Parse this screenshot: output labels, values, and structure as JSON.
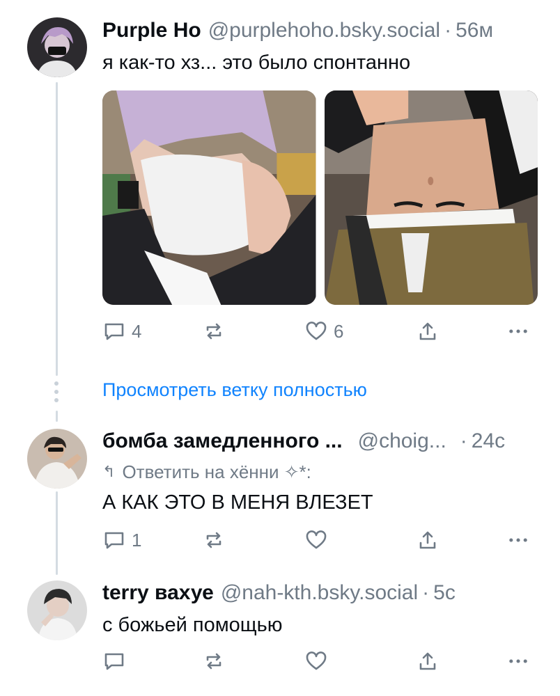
{
  "posts": [
    {
      "author": "Purple Ho",
      "handle": "@purplehoho.bsky.social",
      "time": "56м",
      "text": "я как-то хз... это было спонтанно",
      "actions": {
        "replies": "4",
        "reposts": "",
        "likes": "6"
      }
    },
    {
      "author": "бомба замедленного ...",
      "handle": "@choig...",
      "time": "24с",
      "reply_to": "Ответить на хённи ✧*:",
      "text": "А КАК ЭТО В МЕНЯ ВЛЕЗЕТ",
      "actions": {
        "replies": "1",
        "reposts": "",
        "likes": ""
      }
    },
    {
      "author": "terry вахуе",
      "handle": "@nah-kth.bsky.social",
      "time": "5с",
      "text": "с божьей помощью",
      "actions": {
        "replies": "",
        "reposts": "",
        "likes": ""
      }
    }
  ],
  "view_full_thread": "Просмотреть ветку полностью",
  "separator": "·",
  "icons": {
    "reply": "speech-bubble-icon",
    "repost": "repost-arrows-icon",
    "like": "heart-icon",
    "share": "share-upload-icon",
    "more": "more-dots-icon"
  },
  "colors": {
    "text": "#0b0f14",
    "muted": "#6f7a86",
    "link": "#1083fe",
    "thread_line": "#d4dbe2"
  }
}
